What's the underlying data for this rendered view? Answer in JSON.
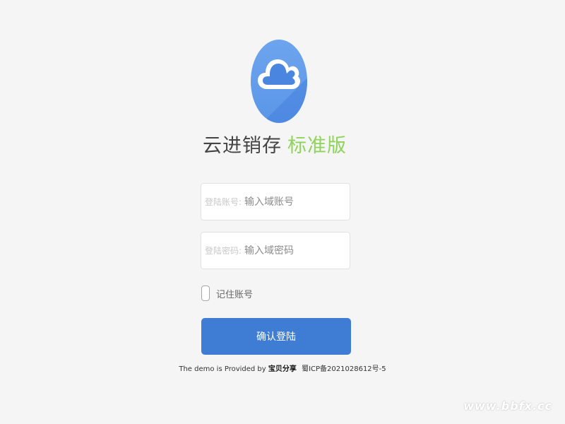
{
  "brand": {
    "logo_icon": "cloud-icon",
    "name": "云进销存",
    "edition": "标准版",
    "colors": {
      "logo_blue": "#6ea4ee",
      "edition_green": "#8ed35a",
      "button_blue": "#3f7dd5"
    }
  },
  "login_form": {
    "username": {
      "label": "登陆账号:",
      "placeholder": "输入域账号",
      "value": ""
    },
    "password": {
      "label": "登陆密码:",
      "placeholder": "输入域密码",
      "value": ""
    },
    "remember": {
      "label": "记住账号",
      "checked": false
    },
    "submit_label": "确认登陆"
  },
  "footer": {
    "prefix": "The demo is Provided by",
    "provider": "宝贝分享",
    "icp": "蜀ICP备2021028612号-5"
  },
  "watermark": "www.bbfx.cc"
}
